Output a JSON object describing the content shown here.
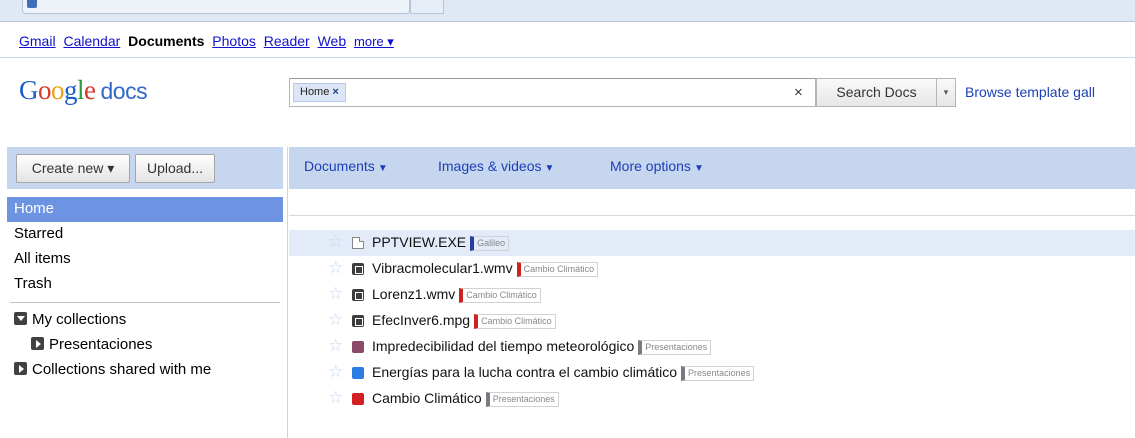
{
  "gbar": {
    "links": [
      "Gmail",
      "Calendar"
    ],
    "current": "Documents",
    "links_after": [
      "Photos",
      "Reader",
      "Web"
    ],
    "more": "more ▾"
  },
  "logo": {
    "google": "Google",
    "product": "docs"
  },
  "search": {
    "chip_label": "Home",
    "chip_close": "×",
    "clear": "×",
    "button": "Search Docs",
    "dropdown": "▾",
    "browse": "Browse template gall"
  },
  "left": {
    "create_new": "Create new ▾",
    "upload": "Upload...",
    "nav": [
      "Home",
      "Starred",
      "All items",
      "Trash"
    ],
    "my_collections": "My collections",
    "presentaciones": "Presentaciones",
    "shared": "Collections shared with me"
  },
  "toolbar": {
    "documents": "Documents",
    "images": "Images & videos",
    "more_options": "More options",
    "arrow": "▼"
  },
  "files": [
    {
      "name": "PPTVIEW.EXE",
      "tag": "Galileo",
      "icon": "doc-icon",
      "color": "#2a3c9c",
      "highlight": true
    },
    {
      "name": "Vibracmolecular1.wmv",
      "tag": "Cambio Climático",
      "icon": "video-icon",
      "color": "#cc2222"
    },
    {
      "name": "Lorenz1.wmv",
      "tag": "Cambio Climático",
      "icon": "video-icon",
      "color": "#cc2222"
    },
    {
      "name": "EfecInver6.mpg",
      "tag": "Cambio Climático",
      "icon": "video-icon",
      "color": "#cc2222"
    },
    {
      "name": "Impredecibilidad del tiempo meteorológico",
      "tag": "Presentaciones",
      "icon": "presentation-icon",
      "icon_color": "#8a4a68",
      "color": "#7a7a82"
    },
    {
      "name": "Energías para la lucha contra el cambio climático",
      "tag": "Presentaciones",
      "icon": "presentation-icon",
      "icon_color": "#2a7de3",
      "color": "#7a7a82"
    },
    {
      "name": "Cambio Climático",
      "tag": "Presentaciones",
      "icon": "presentation-icon",
      "icon_color": "#d42020",
      "color": "#7a7a82"
    }
  ]
}
